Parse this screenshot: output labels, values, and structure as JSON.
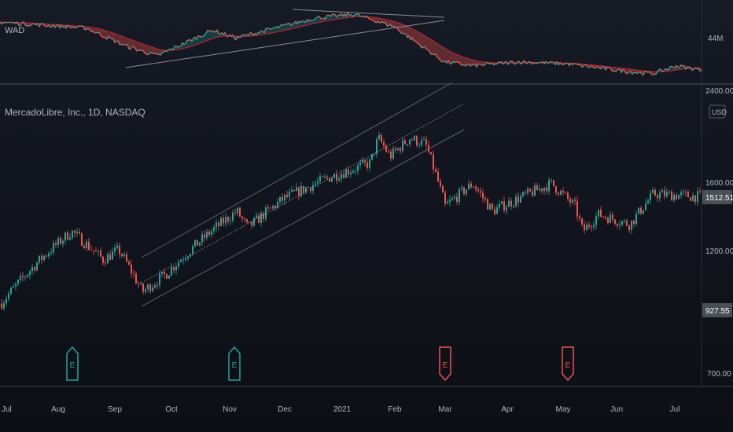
{
  "upper_pane": {
    "indicator_label": "WAD",
    "scale_label": "44M"
  },
  "main_pane": {
    "symbol_label": "MercadoLibre, Inc., 1D, NASDAQ",
    "currency_label": "USD",
    "price_ticks": [
      "2400.00",
      "1600.00",
      "1200.00",
      "700.00"
    ],
    "last_price_badge": "1512.51",
    "marker_price_badge": "927.55"
  },
  "time_axis": {
    "labels": [
      "Jul",
      "Aug",
      "Sep",
      "Oct",
      "Nov",
      "Dec",
      "2021",
      "Feb",
      "Mar",
      "Apr",
      "May",
      "Jun",
      "Jul"
    ]
  },
  "earnings_markers": [
    {
      "label": "E",
      "month": "Aug",
      "kind": "positive"
    },
    {
      "label": "E",
      "month": "Nov",
      "kind": "positive"
    },
    {
      "label": "E",
      "month": "Mar",
      "kind": "negative"
    },
    {
      "label": "E",
      "month": "May",
      "kind": "negative"
    }
  ],
  "colors": {
    "background": "#131722",
    "up": "#26a69a",
    "down": "#ef5350",
    "trendline": "#787b86",
    "text": "#b2b5be",
    "badge_bg": "#4a4e57"
  },
  "chart_data": {
    "type": "candlestick",
    "symbol": "MercadoLibre, Inc., 1D, NASDAQ",
    "x_range": [
      "Jul",
      "Jul"
    ],
    "y_range": [
      700,
      2400
    ],
    "log_scale": true,
    "grid": false,
    "price_path": [
      {
        "month": "Jul",
        "price": 950
      },
      {
        "month": "Aug (early)",
        "price": 1150
      },
      {
        "month": "Aug (mid)",
        "price": 1300
      },
      {
        "month": "Aug (late)",
        "price": 1150
      },
      {
        "month": "Sep (early)",
        "price": 1200
      },
      {
        "month": "Sep (late)",
        "price": 1000
      },
      {
        "month": "Oct (early)",
        "price": 1080
      },
      {
        "month": "Oct (late)",
        "price": 1280
      },
      {
        "month": "Nov (early)",
        "price": 1420
      },
      {
        "month": "Nov (mid)",
        "price": 1320
      },
      {
        "month": "Dec (early)",
        "price": 1500
      },
      {
        "month": "Dec (late)",
        "price": 1650
      },
      {
        "month": "2021",
        "price": 1750
      },
      {
        "month": "Jan (mid)",
        "price": 1950
      },
      {
        "month": "Jan (late)",
        "price": 1800
      },
      {
        "month": "Feb (early)",
        "price": 1950
      },
      {
        "month": "Feb (mid)",
        "price": 1900
      },
      {
        "month": "Mar (early)",
        "price": 1450
      },
      {
        "month": "Mar (mid)",
        "price": 1600
      },
      {
        "month": "Apr (early)",
        "price": 1420
      },
      {
        "month": "Apr (late)",
        "price": 1600
      },
      {
        "month": "May (early)",
        "price": 1450
      },
      {
        "month": "May (mid)",
        "price": 1300
      },
      {
        "month": "Jun (early)",
        "price": 1400
      },
      {
        "month": "Jun (late)",
        "price": 1340
      },
      {
        "month": "Jul (early)",
        "price": 1530
      },
      {
        "month": "Jul (late)",
        "price": 1512.51
      }
    ],
    "wad_path": [
      {
        "month": "Jul",
        "value": 58
      },
      {
        "month": "Aug (mid)",
        "value": 55
      },
      {
        "month": "Sep (early)",
        "value": 46
      },
      {
        "month": "Sep (mid)",
        "value": 41
      },
      {
        "month": "Oct (late)",
        "value": 54
      },
      {
        "month": "Nov (early)",
        "value": 50
      },
      {
        "month": "Dec (mid)",
        "value": 60
      },
      {
        "month": "2021",
        "value": 62
      },
      {
        "month": "Feb (early)",
        "value": 56
      },
      {
        "month": "Mar (early)",
        "value": 38
      },
      {
        "month": "Mar (late)",
        "value": 36
      },
      {
        "month": "Apr (mid)",
        "value": 38
      },
      {
        "month": "May (early)",
        "value": 37
      },
      {
        "month": "May (late)",
        "value": 33
      },
      {
        "month": "Jun (late)",
        "value": 32
      },
      {
        "month": "Jul (early)",
        "value": 36
      },
      {
        "month": "Jul (late)",
        "value": 34
      }
    ]
  }
}
